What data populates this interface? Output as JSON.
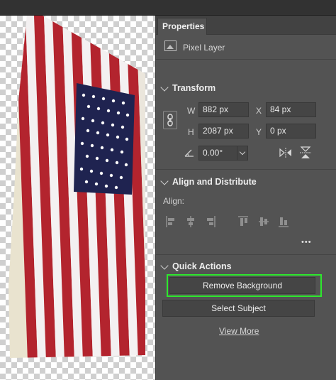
{
  "panel": {
    "tab_label": "Properties",
    "layer_type": "Pixel Layer"
  },
  "transform": {
    "title": "Transform",
    "w_label": "W",
    "w_value": "882 px",
    "h_label": "H",
    "h_value": "2087 px",
    "x_label": "X",
    "x_value": "84 px",
    "y_label": "Y",
    "y_value": "0 px",
    "angle_value": "0.00°"
  },
  "align": {
    "title": "Align and Distribute",
    "align_label": "Align:",
    "more": "•••"
  },
  "quick_actions": {
    "title": "Quick Actions",
    "remove_bg": "Remove Background",
    "select_subject": "Select Subject",
    "view_more": "View More"
  },
  "colors": {
    "panel_bg": "#535353",
    "field_bg": "#454545",
    "highlight": "#2de82d",
    "flag_red": "#b3242e",
    "flag_blue": "#1f2350"
  }
}
